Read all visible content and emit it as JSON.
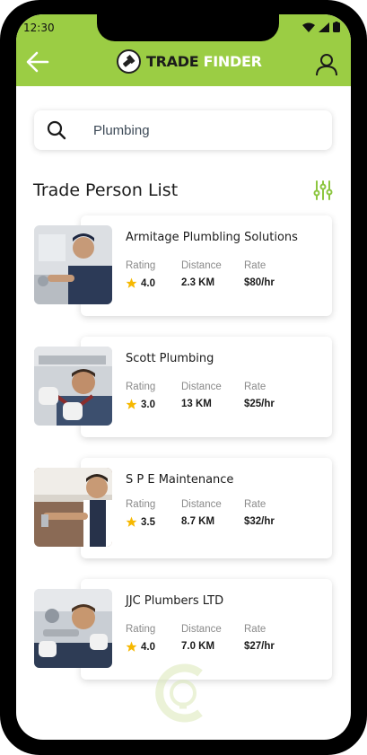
{
  "status": {
    "time": "12:30"
  },
  "header": {
    "brand_word1": "TRADE",
    "brand_word2": "FINDER"
  },
  "search": {
    "value": "Plumbing"
  },
  "section_title": "Trade Person List",
  "labels": {
    "rating": "Rating",
    "distance": "Distance",
    "rate": "Rate"
  },
  "colors": {
    "accent": "#9bcd44",
    "star": "#f6b800"
  },
  "trades": [
    {
      "name": "Armitage Plumbling Solutions",
      "rating": "4.0",
      "distance": "2.3 KM",
      "rate": "$80/hr"
    },
    {
      "name": "Scott Plumbing",
      "rating": "3.0",
      "distance": "13 KM",
      "rate": "$25/hr"
    },
    {
      "name": "S P E Maintenance",
      "rating": "3.5",
      "distance": "8.7 KM",
      "rate": "$32/hr"
    },
    {
      "name": "JJC Plumbers LTD",
      "rating": "4.0",
      "distance": "7.0 KM",
      "rate": "$27/hr"
    }
  ]
}
